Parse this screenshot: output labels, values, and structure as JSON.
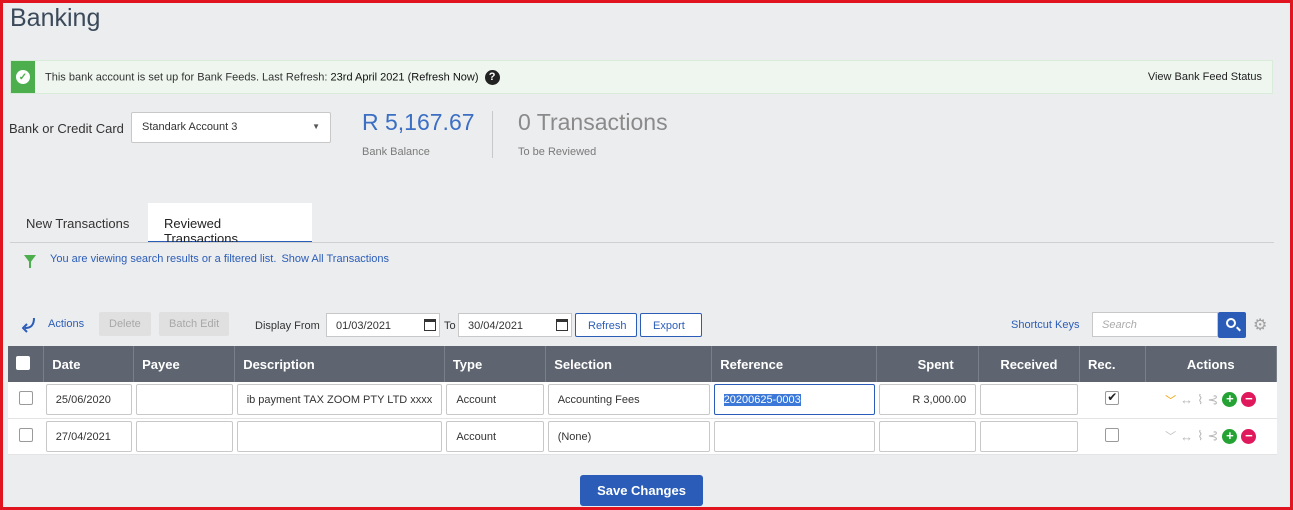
{
  "page": {
    "title": "Banking"
  },
  "feed_banner": {
    "message": "This bank account is set up for Bank Feeds. Last Refresh: ",
    "last_refresh": "23rd April 2021 (Refresh Now)",
    "status_link": "View Bank Feed Status"
  },
  "account": {
    "label": "Bank or Credit Card",
    "selected": "Standark Account 3",
    "balance": "R 5,167.67",
    "balance_label": "Bank Balance",
    "transactions_count": "0 Transactions",
    "transactions_label": "To be Reviewed"
  },
  "tabs": [
    {
      "label": "New Transactions",
      "active": false
    },
    {
      "label": "Reviewed Transactions",
      "active": true
    }
  ],
  "filter": {
    "message": "You are viewing search results or a filtered list.",
    "show_all": "Show All Transactions"
  },
  "toolbar": {
    "actions": "Actions",
    "delete": "Delete",
    "batch_edit": "Batch Edit",
    "display_from": "Display From",
    "from_date": "01/03/2021",
    "to_label": "To",
    "to_date": "30/04/2021",
    "refresh": "Refresh",
    "export": "Export",
    "shortcut_keys": "Shortcut Keys",
    "search_placeholder": "Search"
  },
  "table": {
    "columns": [
      "Date",
      "Payee",
      "Description",
      "Type",
      "Selection",
      "Reference",
      "Spent",
      "Received",
      "Rec.",
      "Actions"
    ],
    "rows": [
      {
        "date": "25/06/2020",
        "payee": "",
        "description": "ib payment TAX ZOOM PTY LTD xxxx",
        "type": "Account",
        "selection": "Accounting Fees",
        "reference": "20200625-0003",
        "spent": "R 3,000.00",
        "received": "",
        "reconciled": true
      },
      {
        "date": "27/04/2021",
        "payee": "",
        "description": "",
        "type": "Account",
        "selection": "(None)",
        "reference": "",
        "spent": "",
        "received": "",
        "reconciled": false
      }
    ]
  },
  "footer": {
    "save": "Save Changes"
  },
  "colors": {
    "accent": "#2b5db8",
    "header": "#5e6570",
    "success": "#4cae4c",
    "danger": "#e0195d",
    "frame": "#e0151f"
  }
}
